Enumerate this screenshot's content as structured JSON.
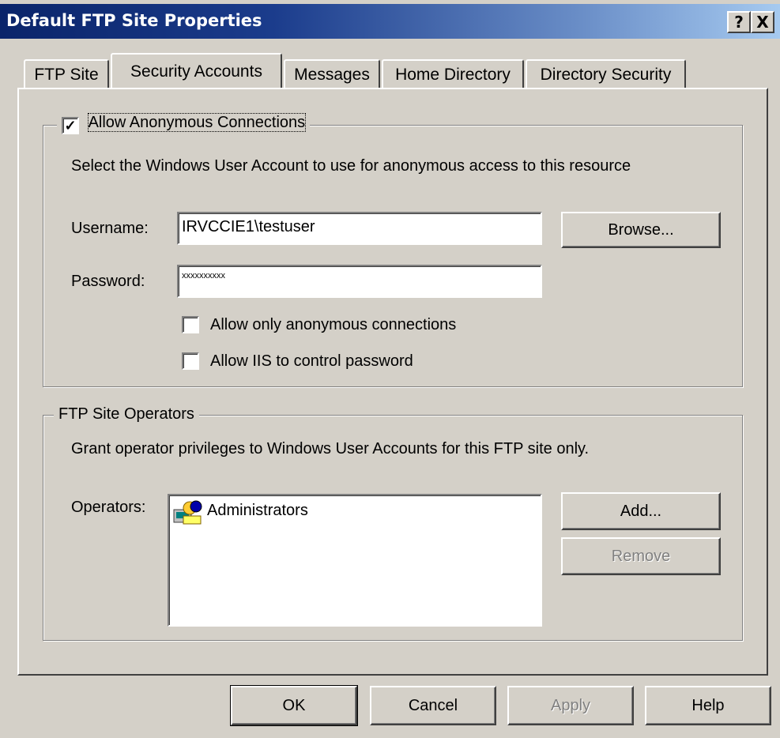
{
  "window": {
    "title": "Default FTP Site Properties",
    "help_glyph": "?",
    "close_glyph": "X"
  },
  "tabs": [
    {
      "label": "FTP Site",
      "active": false
    },
    {
      "label": "Security Accounts",
      "active": true
    },
    {
      "label": "Messages",
      "active": false
    },
    {
      "label": "Home Directory",
      "active": false
    },
    {
      "label": "Directory Security",
      "active": false
    }
  ],
  "anonymous": {
    "checkbox_label": "Allow Anonymous Connections",
    "checked": true,
    "check_glyph": "✓",
    "description": "Select the Windows User Account to use for anonymous access to this resource",
    "username_label": "Username:",
    "username_value": "IRVCCIE1\\testuser",
    "password_label": "Password:",
    "password_value": "xxxxxxxxxx",
    "browse_label": "Browse...",
    "only_anonymous_label": "Allow only anonymous connections",
    "only_anonymous_checked": false,
    "iis_control_label": "Allow IIS to control password",
    "iis_control_checked": false
  },
  "operators": {
    "group_title": "FTP Site Operators",
    "description": "Grant operator privileges to Windows User Accounts for this FTP site only.",
    "operators_label": "Operators:",
    "items": [
      "Administrators"
    ],
    "add_label": "Add...",
    "remove_label": "Remove",
    "remove_enabled": false
  },
  "footer": {
    "ok_label": "OK",
    "cancel_label": "Cancel",
    "apply_label": "Apply",
    "apply_enabled": false,
    "help_label": "Help"
  },
  "colors": {
    "face": "#d4d0c8",
    "title_start": "#0a246a",
    "title_end": "#a6caf0",
    "disabled_text": "#808080"
  }
}
